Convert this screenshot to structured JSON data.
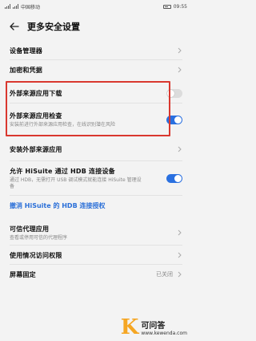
{
  "status_bar": {
    "carrier": "中国移动",
    "time": "09:55"
  },
  "header": {
    "title": "更多安全设置"
  },
  "rows": {
    "device_admin": {
      "title": "设备管理器"
    },
    "encryption": {
      "title": "加密和凭据"
    },
    "external_download": {
      "title": "外部来源应用下载",
      "toggle_on": false
    },
    "external_check": {
      "title": "外部来源应用检查",
      "desc": "安装前进行外部来源应用检查，在线识别潜在风险",
      "toggle_on": true
    },
    "install_external": {
      "title": "安装外部来源应用"
    },
    "hisuite": {
      "title": "允许 HiSuite 通过 HDB 连接设备",
      "desc": "通过 HDB，无需打开 USB 调试模式就能连接 HiSuite 管理设备",
      "toggle_on": true
    },
    "revoke": {
      "title": "撤消 HiSuite 的 HDB 连接授权"
    },
    "trusted_proxy": {
      "title": "可信代理应用",
      "desc": "查看或停用可信的代理程序"
    },
    "usage_access": {
      "title": "使用情况访问权限"
    },
    "screen_pin": {
      "title": "屏幕固定",
      "value": "已关闭"
    }
  },
  "watermark": {
    "logo_text": "K",
    "title": "可问答",
    "url": "www.kewenda.com"
  },
  "colors": {
    "accent": "#2a70e0",
    "highlight": "#d9382f",
    "link": "#2a6fd8"
  }
}
